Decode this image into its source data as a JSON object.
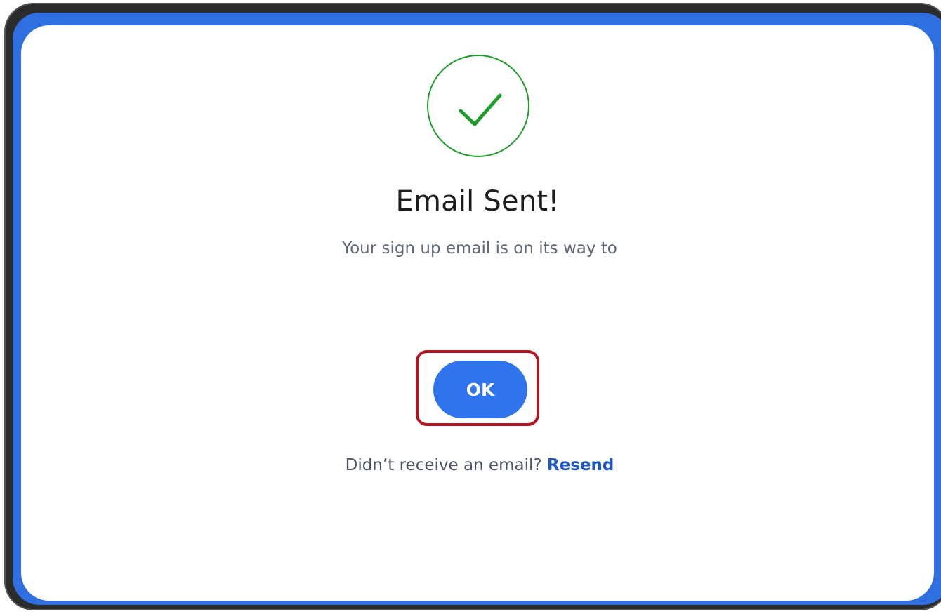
{
  "dialog": {
    "icon": "checkmark-circle-icon",
    "title": "Email Sent!",
    "message": "Your sign up email is on its way to",
    "ok_button_label": "OK",
    "resend_prompt": "Didn’t receive an email?",
    "resend_link_label": "Resend"
  },
  "colors": {
    "success": "#1f9d2a",
    "primary_button": "#2f74ec",
    "link": "#1f56c2",
    "frame_accent": "#2f6fe0",
    "highlight": "#b01521"
  }
}
